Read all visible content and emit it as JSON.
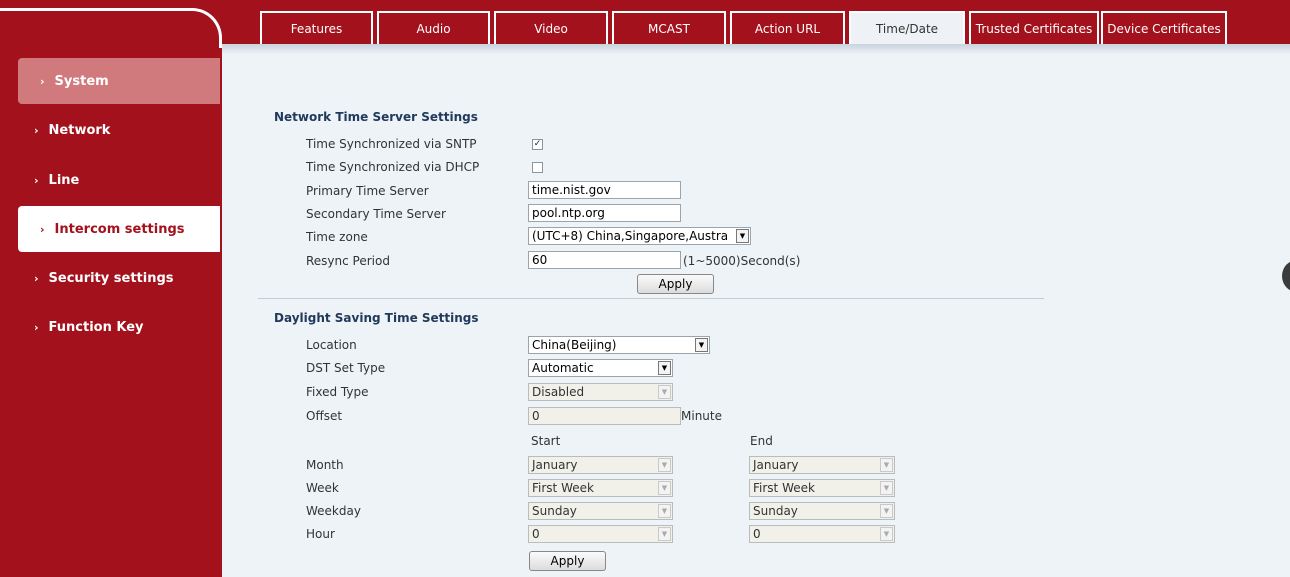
{
  "tabs": [
    {
      "label": "Features",
      "active": false
    },
    {
      "label": "Audio",
      "active": false
    },
    {
      "label": "Video",
      "active": false
    },
    {
      "label": "MCAST",
      "active": false
    },
    {
      "label": "Action URL",
      "active": false
    },
    {
      "label": "Time/Date",
      "active": true
    },
    {
      "label": "Trusted Certificates",
      "active": false
    },
    {
      "label": "Device Certificates",
      "active": false
    }
  ],
  "sidebar": {
    "items": [
      {
        "label": "System"
      },
      {
        "label": "Network"
      },
      {
        "label": "Line"
      },
      {
        "label": "Intercom settings"
      },
      {
        "label": "Security settings"
      },
      {
        "label": "Function Key"
      }
    ],
    "chevron": "›"
  },
  "ntp": {
    "title": "Network Time Server Settings",
    "sntp_label": "Time Synchronized via SNTP",
    "sntp_checked": true,
    "dhcp_label": "Time Synchronized via DHCP",
    "dhcp_checked": false,
    "primary_label": "Primary Time Server",
    "primary_value": "time.nist.gov",
    "secondary_label": "Secondary Time Server",
    "secondary_value": "pool.ntp.org",
    "timezone_label": "Time zone",
    "timezone_value": "(UTC+8) China,Singapore,Austra",
    "resync_label": "Resync Period",
    "resync_value": "60",
    "resync_hint": "(1~5000)Second(s)",
    "apply_label": "Apply"
  },
  "dst": {
    "title": "Daylight Saving Time Settings",
    "location_label": "Location",
    "location_value": "China(Beijing)",
    "dst_type_label": "DST Set Type",
    "dst_type_value": "Automatic",
    "fixed_type_label": "Fixed Type",
    "fixed_type_value": "Disabled",
    "offset_label": "Offset",
    "offset_value": "0",
    "offset_unit": "Minute",
    "start_header": "Start",
    "end_header": "End",
    "month_label": "Month",
    "week_label": "Week",
    "weekday_label": "Weekday",
    "hour_label": "Hour",
    "start": {
      "month": "January",
      "week": "First Week",
      "weekday": "Sunday",
      "hour": "0"
    },
    "end": {
      "month": "January",
      "week": "First Week",
      "weekday": "Sunday",
      "hour": "0"
    },
    "apply_label": "Apply"
  },
  "icons": {
    "checkmark": "✓",
    "dropdown": "▼"
  }
}
